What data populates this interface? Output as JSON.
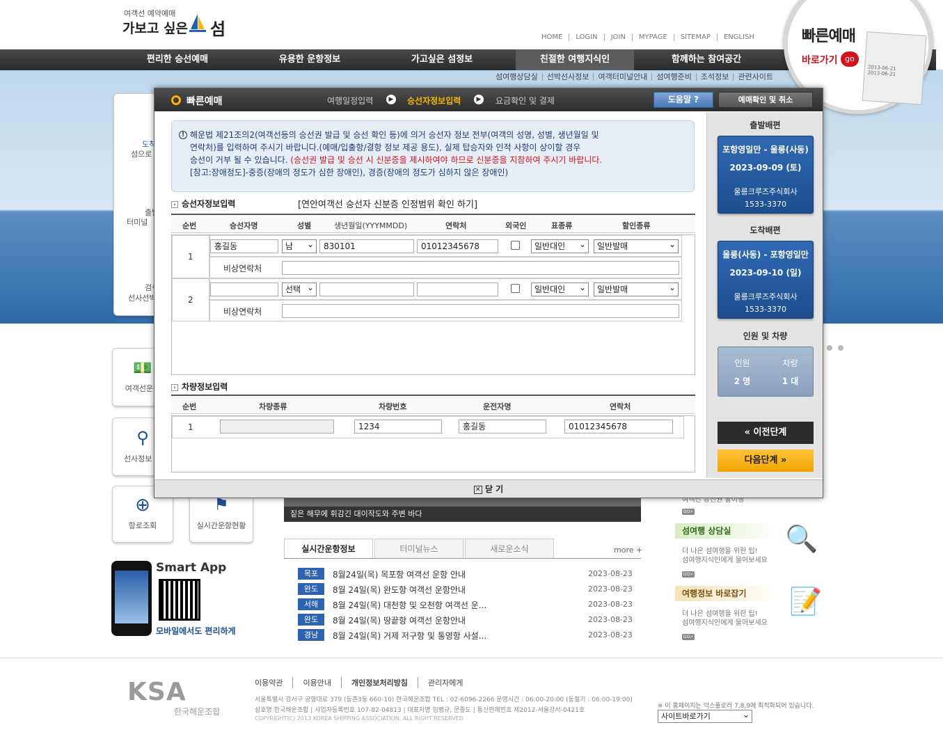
{
  "header": {
    "logo_small": "여객선 예약예매",
    "logo_big": "가보고 싶은",
    "logo_seom": "섬",
    "topnav": [
      "HOME",
      "LOGIN",
      "JOIN",
      "MYPAGE",
      "SITEMAP",
      "ENGLISH"
    ],
    "gnb": [
      "편리한 승선예매",
      "유용한 운항정보",
      "가고싶은 섬정보",
      "친절한 여행지식인",
      "함께하는 참여공간"
    ],
    "subnav": [
      "섬여행상담실",
      "선박선사정보",
      "여객터미널안내",
      "섬여행준비",
      "조석정보",
      "관련사이트"
    ],
    "quick_title": "빠른예매",
    "quick_go": "바로가기",
    "quick_go_badge": "go",
    "ticket_date1": "2013-06-21",
    "ticket_date2": "2013-06-21"
  },
  "modal": {
    "title": "빠른예매",
    "steps": [
      "여행일정입력",
      "승선자정보입력",
      "요금확인 및 결제"
    ],
    "help_label": "도움말",
    "confirm_label": "예매확인 및 취소",
    "notice_lines": [
      "해운법 제21조의2(여객선등의 승선권 발급 및 승선 확인 등)에 의거 승선자 정보 전부(여객의 성명, 성별, 생년월일 및",
      "연락처)를 입력하여 주시기 바랍니다.(예매/입출항/결항 정보 제공 용도), 실제 탑승자와 인적 사항이 상이할 경우",
      "승선이 거부 될 수 있습니다.",
      "(승선권 발급 및 승선 시 신분증을 제시하여야 하므로 신분증을 지참하여 주시기 바랍니다.",
      "[참고:장애정도]-중증(장애의 정도가 심한 장애인), 경증(장애의 정도가 심하지 않은 장애인)"
    ],
    "passenger_section": "승선자정보입력",
    "verify_link": "[연안여객선 승선자 신분증 인정범위 확인 하기]",
    "passenger_headers": [
      "순번",
      "승선자명",
      "성별",
      "생년월일(YYYMMDD)",
      "연락처",
      "외국인",
      "표종류",
      "할인종류"
    ],
    "passengers": [
      {
        "no": "1",
        "name": "홍길동",
        "gender": "남",
        "birth": "830101",
        "phone": "01012345678",
        "ticket": "일반대인",
        "discount": "일반발매",
        "emergency_label": "비상연락처"
      },
      {
        "no": "2",
        "name": "",
        "gender": "선택",
        "birth": "",
        "phone": "",
        "ticket": "일반대인",
        "discount": "일반발매",
        "emergency_label": "비상연락처"
      }
    ],
    "vehicle_section": "차량정보입력",
    "vehicle_headers": [
      "순번",
      "차량종류",
      "차량번호",
      "운전자명",
      "연락처"
    ],
    "vehicles": [
      {
        "no": "1",
        "type": "",
        "number": "1234",
        "driver": "홍길동",
        "phone": "01012345678"
      }
    ],
    "close_label": "닫 기",
    "right_panel": {
      "depart_title": "출발배편",
      "depart_route": "포항영일만 - 울릉(사동)",
      "depart_date": "2023-09-09 (토)",
      "depart_company": "울릉크루즈주식회사",
      "depart_phone": "1533-3370",
      "arrive_title": "도착배편",
      "arrive_route": "울릉(사동) - 포항영일만",
      "arrive_date": "2023-09-10 (일)",
      "arrive_company": "울릉크루즈주식회사",
      "arrive_phone": "1533-3370",
      "people_title": "인원 및 차량",
      "people_label": "인원",
      "vehicle_label": "차량",
      "people_value": "2 명",
      "vehicle_value": "1 대",
      "prev_label": "이전단계",
      "next_label": "다음단계"
    }
  },
  "background": {
    "left_menu": [
      "도착",
      "섬으로",
      "출발",
      "터미널",
      "검색",
      "선사선박"
    ],
    "left_tiles": [
      "여객선운임",
      "선사정보 조",
      "항로조회",
      "실시간운항현황"
    ],
    "smart_app": "Smart App",
    "smart_app_sub": "모바일에서도 편리하게",
    "caption": "짙은 해무에 휘감긴 대이작도와 주변 바다",
    "news_tabs": [
      "실시간운항정보",
      "터미널뉴스",
      "새로운소식"
    ],
    "more_label": "more +",
    "news": [
      {
        "badge": "목포",
        "text": "8월24일(목) 목포항 여객선 운항 안내",
        "date": "2023-08-23"
      },
      {
        "badge": "완도",
        "text": "8월 24일(목) 완도항 여객선 운항안내",
        "date": "2023-08-23"
      },
      {
        "badge": "서해",
        "text": "8월 24일(목) 대천항 및 오천항 여객선 운...",
        "date": "2023-08-23"
      },
      {
        "badge": "완도",
        "text": "8월 24일(목) 땅끝항 여객선 운항안내",
        "date": "2023-08-23"
      },
      {
        "badge": "경남",
        "text": "8월 24일(목) 거제 저구항 및 통영항 사설...",
        "date": "2023-08-23"
      }
    ],
    "right_cards": [
      {
        "title": "섬여행 상담실",
        "text1": "더 나은 섬여행을 위한 팁!",
        "text2": "섬여행지식인에게 물어보세요"
      },
      {
        "title": "여행정보 바로잡기",
        "text1": "더 나은 섬여행을 위한 팁!",
        "text2": "섬여행지식인에게 물어보세요"
      }
    ],
    "right_top_text": "여객선 승선권 불이행",
    "go_tag": "GO>"
  },
  "footer": {
    "links": [
      "이용약관",
      "이용안내",
      "개인정보처리방침",
      "관리자에게"
    ],
    "org": "한국해운조합",
    "address": "서울특별시 강서구 공항대로 379 (등촌3동 660-10) 한국해운조합  TEL : 02-6096-2266  운영시간 : 06:00-20:00 (동절기 : 06:00-19:00)",
    "company": "상호명 한국해운조합 | 사업자등록번호 107-82-04813 | 대표자명 임병규, 문종도 | 통신판매번호 제2012-서울강서-0421호",
    "copyright": "COPYRIGHT(C) 2013 KOREA SHIPPING ASSOCIATION. ALL RIGHT RESERVED",
    "browser_note": "※ 이 홈페이지는 익스플로러 7,8,9에 최적화되어 있습니다.",
    "site_select": "사이트바로가기",
    "ksa": "KSA"
  }
}
